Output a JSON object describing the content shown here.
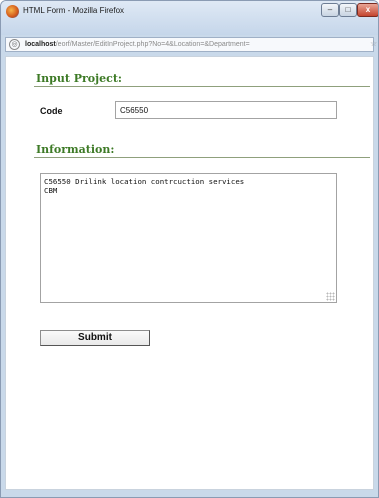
{
  "window": {
    "title": "HTML Form - Mozilla Firefox",
    "controls": {
      "minimize": "–",
      "maximize": "□",
      "close": "x"
    }
  },
  "addressbar": {
    "host": "localhost",
    "path": "/eorf/Master/EditInProject.php?No=4&Location=&Department="
  },
  "form": {
    "input_project_title": "Input Project:",
    "code_label": "Code",
    "code_value": "C56550",
    "information_title": "Information:",
    "information_value": "C56550 Drilink location contrcuction services\nCBM",
    "submit_label": "Submit"
  },
  "colors": {
    "section_title": "#3d7a26",
    "window_frame": "#c9d9ea",
    "close_button": "#c4452f"
  }
}
